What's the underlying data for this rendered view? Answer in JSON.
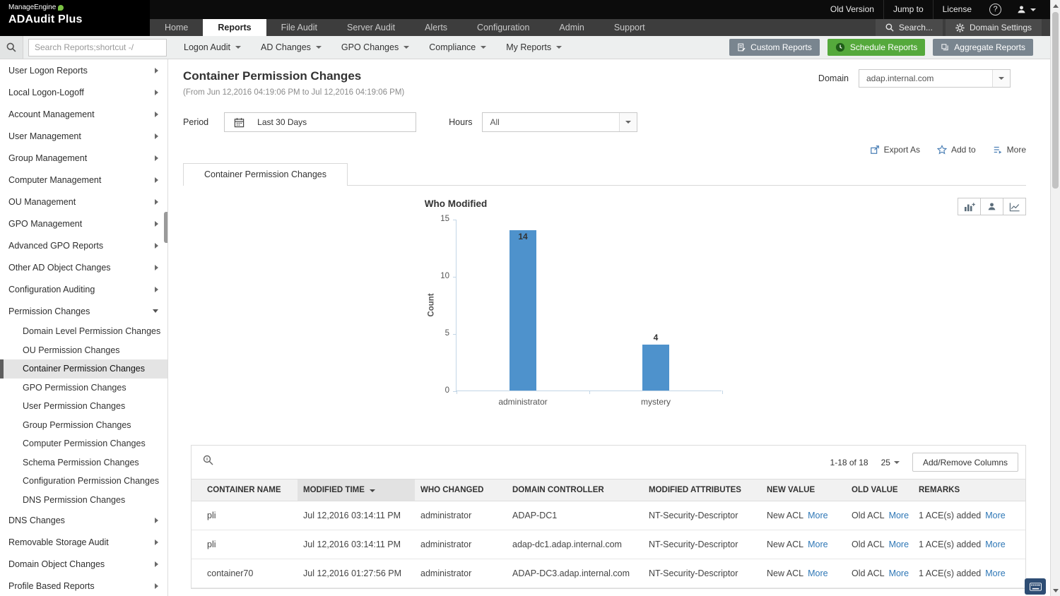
{
  "topbar": {
    "old_version": "Old Version",
    "jump_to": "Jump to",
    "license": "License",
    "help": "?"
  },
  "navbar": {
    "brand_top": "ManageEngine",
    "brand_bottom": "ADAudit Plus",
    "tabs": [
      "Home",
      "Reports",
      "File Audit",
      "Server Audit",
      "Alerts",
      "Configuration",
      "Admin",
      "Support"
    ],
    "active_tab": "Reports",
    "search": "Search...",
    "domain_settings": "Domain Settings"
  },
  "toolbar": {
    "search_placeholder": "Search Reports;shortcut -/",
    "menus": [
      "Logon Audit",
      "AD Changes",
      "GPO Changes",
      "Compliance",
      "My Reports"
    ],
    "buttons": {
      "custom": "Custom Reports",
      "schedule": "Schedule Reports",
      "aggregate": "Aggregate Reports"
    }
  },
  "sidebar": {
    "items": [
      {
        "label": "User Logon Reports",
        "type": "group"
      },
      {
        "label": "Local Logon-Logoff",
        "type": "group"
      },
      {
        "label": "Account Management",
        "type": "group"
      },
      {
        "label": "User Management",
        "type": "group"
      },
      {
        "label": "Group Management",
        "type": "group"
      },
      {
        "label": "Computer Management",
        "type": "group"
      },
      {
        "label": "OU Management",
        "type": "group"
      },
      {
        "label": "GPO Management",
        "type": "group"
      },
      {
        "label": "Advanced GPO Reports",
        "type": "group"
      },
      {
        "label": "Other AD Object Changes",
        "type": "group"
      },
      {
        "label": "Configuration Auditing",
        "type": "group"
      },
      {
        "label": "Permission Changes",
        "type": "group",
        "expanded": true
      },
      {
        "label": "Domain Level Permission Changes",
        "type": "child"
      },
      {
        "label": "OU Permission Changes",
        "type": "child"
      },
      {
        "label": "Container Permission Changes",
        "type": "child",
        "selected": true
      },
      {
        "label": "GPO Permission Changes",
        "type": "child"
      },
      {
        "label": "User Permission Changes",
        "type": "child"
      },
      {
        "label": "Group Permission Changes",
        "type": "child"
      },
      {
        "label": "Computer Permission Changes",
        "type": "child"
      },
      {
        "label": "Schema Permission Changes",
        "type": "child"
      },
      {
        "label": "Configuration Permission Changes",
        "type": "child"
      },
      {
        "label": "DNS Permission Changes",
        "type": "child"
      },
      {
        "label": "DNS Changes",
        "type": "group"
      },
      {
        "label": "Removable Storage Audit",
        "type": "group"
      },
      {
        "label": "Domain Object Changes",
        "type": "group"
      },
      {
        "label": "Profile Based Reports",
        "type": "group"
      }
    ]
  },
  "report": {
    "title": "Container Permission Changes",
    "date_range": "(From Jun 12,2016 04:19:06 PM to Jul 12,2016 04:19:06 PM)",
    "domain_label": "Domain",
    "domain_value": "adap.internal.com",
    "period_label": "Period",
    "period_value": "Last 30 Days",
    "hours_label": "Hours",
    "hours_value": "All",
    "actions": {
      "export": "Export As",
      "add": "Add to",
      "more": "More"
    },
    "tab": "Container Permission Changes"
  },
  "chart_data": {
    "type": "bar",
    "title": "Who Modified",
    "categories": [
      "administrator",
      "mystery"
    ],
    "values": [
      14,
      4
    ],
    "xlabel": "",
    "ylabel": "Count",
    "ylim": [
      0,
      15
    ],
    "yticks": [
      0,
      5,
      10,
      15
    ],
    "bar_color": "#4e92cc",
    "grid": false,
    "legend": false
  },
  "table": {
    "pagination": "1-18 of 18",
    "page_size": "25",
    "add_remove_columns": "Add/Remove Columns",
    "columns": [
      "CONTAINER NAME",
      "MODIFIED TIME",
      "WHO CHANGED",
      "DOMAIN CONTROLLER",
      "MODIFIED ATTRIBUTES",
      "NEW VALUE",
      "OLD VALUE",
      "REMARKS"
    ],
    "sorted_column": "MODIFIED TIME",
    "more_label": "More",
    "rows": [
      {
        "container": "pli",
        "time": "Jul 12,2016 03:14:11 PM",
        "who": "administrator",
        "dc": "ADAP-DC1",
        "attrs": "NT-Security-Descriptor",
        "new_value": "New ACL",
        "old_value": "Old ACL",
        "remarks": "1 ACE(s) added"
      },
      {
        "container": "pli",
        "time": "Jul 12,2016 03:14:11 PM",
        "who": "administrator",
        "dc": "adap-dc1.adap.internal.com",
        "attrs": "NT-Security-Descriptor",
        "new_value": "New ACL",
        "old_value": "Old ACL",
        "remarks": "1 ACE(s) added"
      },
      {
        "container": "container70",
        "time": "Jul 12,2016 01:27:56 PM",
        "who": "administrator",
        "dc": "ADAP-DC3.adap.internal.com",
        "attrs": "NT-Security-Descriptor",
        "new_value": "New ACL",
        "old_value": "Old ACL",
        "remarks": "1 ACE(s) added"
      }
    ]
  }
}
